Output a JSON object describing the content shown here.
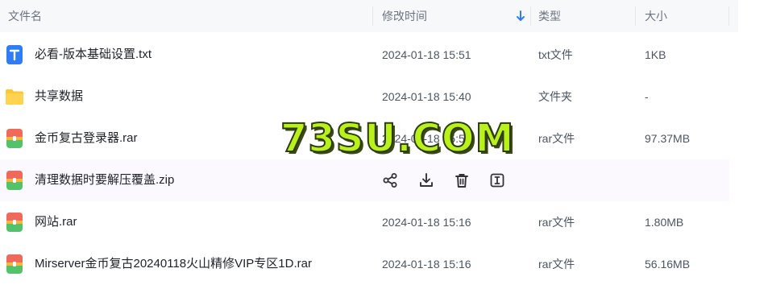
{
  "header": {
    "name_label": "文件名",
    "modified_label": "修改时间",
    "type_label": "类型",
    "size_label": "大小"
  },
  "files": [
    {
      "name": "必看-版本基础设置.txt",
      "modified": "2024-01-18 15:51",
      "type": "txt文件",
      "size": "1KB",
      "icon": "txt-file-icon"
    },
    {
      "name": "共享数据",
      "modified": "2024-01-18 15:40",
      "type": "文件夹",
      "size": "-",
      "icon": "folder-icon"
    },
    {
      "name": "金币复古登录器.rar",
      "modified": "2024-01-18 15:5",
      "type": "rar文件",
      "size": "97.37MB",
      "icon": "archive-icon"
    },
    {
      "name": "清理数据时要解压覆盖.zip",
      "modified": "",
      "type": "",
      "size": "",
      "icon": "archive-icon"
    },
    {
      "name": "网站.rar",
      "modified": "2024-01-18 15:16",
      "type": "rar文件",
      "size": "1.80MB",
      "icon": "archive-icon"
    },
    {
      "name": "Mirserver金币复古20240118火山精修VIP专区1D.rar",
      "modified": "2024-01-18 15:16",
      "type": "rar文件",
      "size": "56.16MB",
      "icon": "archive-icon"
    }
  ],
  "hover_actions": [
    "share-icon",
    "download-icon",
    "delete-icon",
    "rename-icon"
  ],
  "watermark": "73SU.COM",
  "colors": {
    "txt_icon": "#2f7df6",
    "folder": "#ffc533",
    "archive_red": "#ef6a5b",
    "archive_green": "#54c26a",
    "archive_band": "#f4b63d",
    "watermark": "#b9f21a"
  }
}
